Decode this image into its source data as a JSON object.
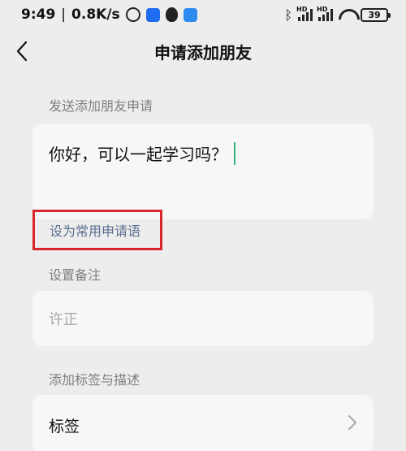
{
  "status_bar": {
    "time": "9:49",
    "separator": "|",
    "net_speed": "0.8K/s",
    "signal_label_1": "HD",
    "signal_label_2": "HD",
    "battery": "39"
  },
  "nav": {
    "back_icon": "chevron-left-icon",
    "title": "申请添加朋友"
  },
  "request": {
    "section_label": "发送添加朋友申请",
    "message": "你好，可以一起学习吗？",
    "set_common_label": "设为常用申请语",
    "highlight_color": "#d9262c"
  },
  "remark": {
    "section_label": "设置备注",
    "placeholder": "许正"
  },
  "tags": {
    "section_label": "添加标签与描述",
    "row_label": "标签",
    "chevron_icon": "chevron-right-icon"
  },
  "colors": {
    "background": "#ededed",
    "card": "#f7f7f7",
    "caret": "#2fb37b",
    "link": "#5a6f8f"
  }
}
